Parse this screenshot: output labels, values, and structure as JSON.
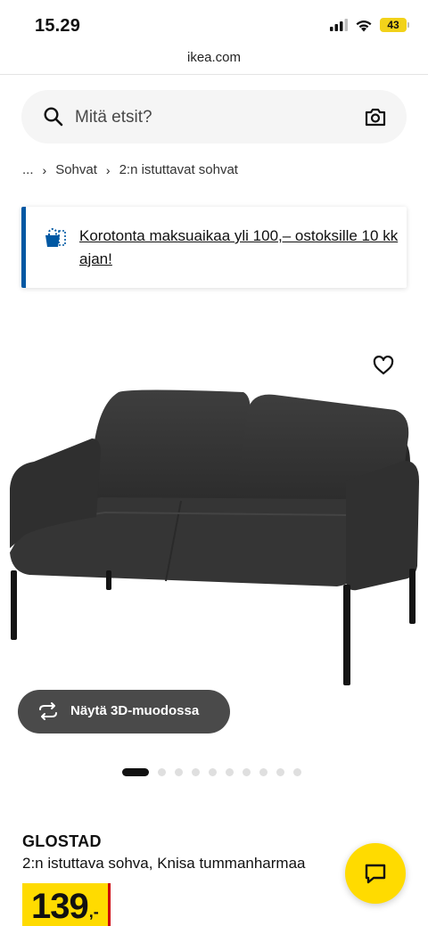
{
  "status_bar": {
    "time": "15.29",
    "battery": "43",
    "icons": [
      "signal-icon",
      "wifi-icon",
      "battery-icon"
    ]
  },
  "browser": {
    "url": "ikea.com"
  },
  "search": {
    "placeholder": "Mitä etsit?",
    "icons": [
      "search-icon",
      "camera-icon"
    ]
  },
  "breadcrumb": {
    "ellipsis": "...",
    "items": [
      "Sohvat",
      "2:n istuttavat sohvat"
    ]
  },
  "promo": {
    "text": "Korotonta maksuaikaa yli 100,– ostoksille 10 kk ajan!",
    "icon": "shopping-bag-icon",
    "accent": "#0058a3"
  },
  "gallery": {
    "view_3d_label": "Näytä 3D-muodossa",
    "image_count": 10,
    "active_index": 0,
    "icons": [
      "heart-icon",
      "rotate-icon"
    ]
  },
  "product": {
    "name": "GLOSTAD",
    "description": "2:n istuttava sohva, Knisa tummanharmaa",
    "price": "139",
    "price_suffix": ",-",
    "price_bg": "#ffdb00",
    "price_accent": "#cc0008"
  },
  "chat": {
    "icon": "chat-icon",
    "color": "#ffdb00"
  }
}
